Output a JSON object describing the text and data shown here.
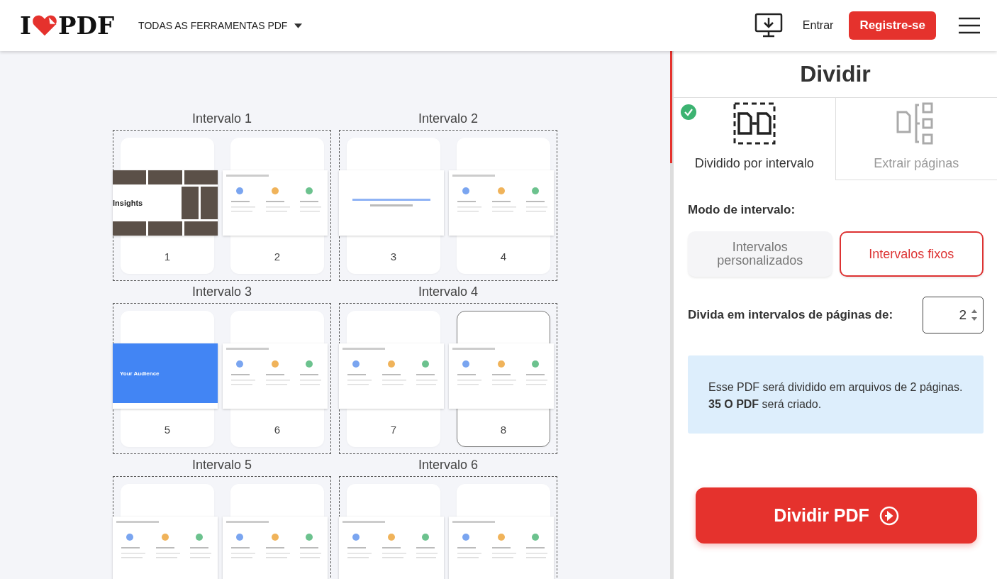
{
  "header": {
    "logo": {
      "left": "I",
      "right": "PDF"
    },
    "nav_menu": "TODAS AS FERRAMENTAS PDF",
    "login": "Entrar",
    "register": "Registre-se"
  },
  "intervals": [
    {
      "label": "Intervalo 1",
      "pages": [
        {
          "number": "1",
          "selected": false,
          "slide": {
            "kind": "photos",
            "title": "Insights"
          }
        },
        {
          "number": "2",
          "selected": false,
          "slide": {
            "kind": "content"
          }
        }
      ]
    },
    {
      "label": "Intervalo 2",
      "pages": [
        {
          "number": "3",
          "selected": false,
          "slide": {
            "kind": "statement"
          }
        },
        {
          "number": "4",
          "selected": false,
          "slide": {
            "kind": "content"
          }
        }
      ]
    },
    {
      "label": "Intervalo 3",
      "pages": [
        {
          "number": "5",
          "selected": false,
          "slide": {
            "kind": "cover",
            "title": "Your Audience"
          }
        },
        {
          "number": "6",
          "selected": false,
          "slide": {
            "kind": "content"
          }
        }
      ]
    },
    {
      "label": "Intervalo 4",
      "pages": [
        {
          "number": "7",
          "selected": false,
          "slide": {
            "kind": "content"
          }
        },
        {
          "number": "8",
          "selected": true,
          "slide": {
            "kind": "content"
          }
        }
      ]
    },
    {
      "label": "Intervalo 5",
      "pages": [
        {
          "selected": false,
          "slide": {
            "kind": "content"
          }
        },
        {
          "selected": false,
          "slide": {
            "kind": "content"
          }
        }
      ]
    },
    {
      "label": "Intervalo 6",
      "pages": [
        {
          "selected": false,
          "slide": {
            "kind": "content"
          }
        },
        {
          "selected": false,
          "slide": {
            "kind": "content"
          }
        }
      ]
    }
  ],
  "panel": {
    "title": "Dividir",
    "tabs": [
      {
        "label": "Dividido por intervalo",
        "selected": true,
        "kind": "range"
      },
      {
        "label": "Extrair páginas",
        "selected": false,
        "kind": "extract"
      }
    ],
    "mode_label": "Modo de intervalo:",
    "modes": [
      {
        "label": "Intervalos personalizados",
        "selected": false
      },
      {
        "label": "Intervalos fixos",
        "selected": true
      }
    ],
    "interval_field": {
      "label": "Divida em intervalos de páginas de:",
      "value": "2"
    },
    "info": [
      "Esse PDF será dividido em arquivos de 2 páginas.",
      "**35 O PDF** será criado."
    ],
    "submit": "Dividir PDF"
  }
}
